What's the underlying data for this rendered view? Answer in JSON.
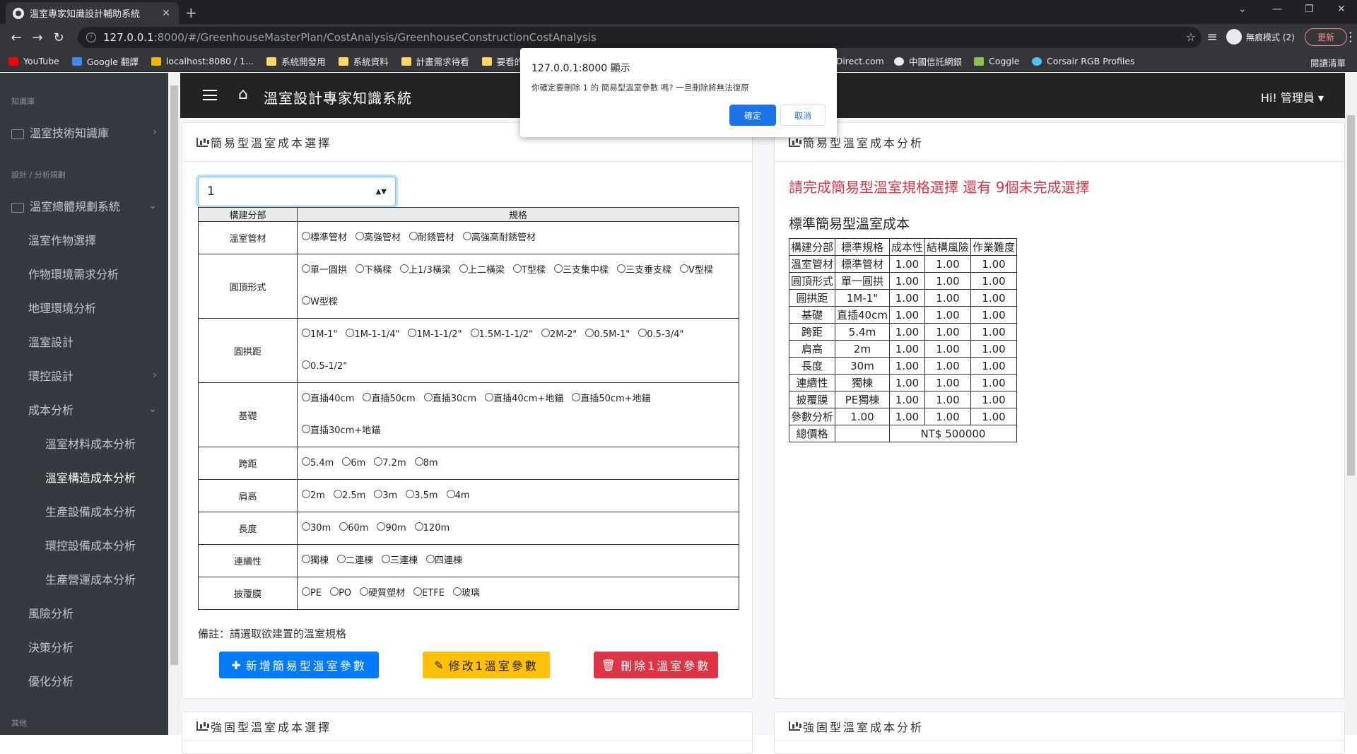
{
  "browser": {
    "tab_title": "溫室專家知識設計輔助系統",
    "url_host": "127.0.0.1",
    "url_path": ":8000/#/GreenhouseMasterPlan/CostAnalysis/GreenhouseConstructionCostAnalysis",
    "incognito_label": "無痕模式 (2)",
    "update_label": "更新",
    "reading_list": "閱讀清單",
    "bookmarks": [
      "YouTube",
      "Google 翻譯",
      "localhost:8080 / 1...",
      "系統開發用",
      "系統資料",
      "計畫需求待看",
      "要看的分",
      "eDirect.com",
      "中國信託網銀",
      "Coggle",
      "Corsair RGB Profiles"
    ]
  },
  "sidebar": {
    "head1": "知識庫",
    "item_kb": "溫室技術知識庫",
    "head2": "設計 / 分析規劃",
    "item_plan": "溫室總體規劃系統",
    "items": [
      "溫室作物選擇",
      "作物環境需求分析",
      "地理環境分析",
      "溫室設計",
      "環控設計",
      "成本分析"
    ],
    "subitems": [
      "溫室材料成本分析",
      "溫室構造成本分析",
      "生產設備成本分析",
      "環控設備成本分析",
      "生產營運成本分析"
    ],
    "items2": [
      "風險分析",
      "決策分析",
      "優化分析"
    ],
    "head3": "其他"
  },
  "navbar": {
    "brand": "溫室設計專家知識系統",
    "user": "Hi! 管理員"
  },
  "left_card": {
    "title": "簡易型溫室成本選擇",
    "select_value": "1",
    "col_part": "構建分部",
    "col_spec": "規格",
    "rows": [
      {
        "part": "溫室管材",
        "options": [
          "標準管材",
          "高強管材",
          "耐銹管材",
          "高強高耐銹管材"
        ]
      },
      {
        "part": "圓頂形式",
        "options": [
          "單一圓拱",
          "下橫樑",
          "上1/3橫梁",
          "上二橫梁",
          "T型樑",
          "三支集中樑",
          "三支垂支樑",
          "V型樑",
          "W型樑"
        ]
      },
      {
        "part": "圓拱距",
        "options": [
          "1M-1\"",
          "1M-1-1/4\"",
          "1M-1-1/2\"",
          "1.5M-1-1/2\"",
          "2M-2\"",
          "0.5M-1\"",
          "0.5-3/4\"",
          "0.5-1/2\""
        ]
      },
      {
        "part": "基礎",
        "options": [
          "直插40cm",
          "直插50cm",
          "直插30cm",
          "直插40cm+地錨",
          "直插50cm+地錨",
          "直插30cm+地錨"
        ]
      },
      {
        "part": "跨距",
        "options": [
          "5.4m",
          "6m",
          "7.2m",
          "8m"
        ]
      },
      {
        "part": "肩高",
        "options": [
          "2m",
          "2.5m",
          "3m",
          "3.5m",
          "4m"
        ]
      },
      {
        "part": "長度",
        "options": [
          "30m",
          "60m",
          "90m",
          "120m"
        ]
      },
      {
        "part": "連續性",
        "options": [
          "獨棟",
          "二連棟",
          "三連棟",
          "四連棟"
        ]
      },
      {
        "part": "披覆膜",
        "options": [
          "PE",
          "PO",
          "硬質塑材",
          "ETFE",
          "玻璃"
        ]
      }
    ],
    "note": "備註：請選取欲建置的溫室規格",
    "btn_add": "新增簡易型溫室參數",
    "btn_edit": "修改1溫室參數",
    "btn_delete": "刪除1溫室參數"
  },
  "right_card": {
    "title": "簡易型溫室成本分析",
    "warning": "請完成簡易型溫室規格選擇 還有 9個未完成選擇",
    "table_title": "標準簡易型溫室成本",
    "headers": [
      "構建分部",
      "標準規格",
      "成本性",
      "結構風險",
      "作業難度"
    ],
    "rows": [
      [
        "溫室管材",
        "標準管材",
        "1.00",
        "1.00",
        "1.00"
      ],
      [
        "圓頂形式",
        "單一圓拱",
        "1.00",
        "1.00",
        "1.00"
      ],
      [
        "圓拱距",
        "1M-1\"",
        "1.00",
        "1.00",
        "1.00"
      ],
      [
        "基礎",
        "直插40cm",
        "1.00",
        "1.00",
        "1.00"
      ],
      [
        "跨距",
        "5.4m",
        "1.00",
        "1.00",
        "1.00"
      ],
      [
        "肩高",
        "2m",
        "1.00",
        "1.00",
        "1.00"
      ],
      [
        "長度",
        "30m",
        "1.00",
        "1.00",
        "1.00"
      ],
      [
        "連續性",
        "獨棟",
        "1.00",
        "1.00",
        "1.00"
      ],
      [
        "披覆膜",
        "PE獨棟",
        "1.00",
        "1.00",
        "1.00"
      ],
      [
        "參數分析",
        "1.00",
        "1.00",
        "1.00",
        "1.00"
      ]
    ],
    "total_label": "總價格",
    "total_value": "NT$ 500000"
  },
  "bottom_cards": {
    "left": "強固型溫室成本選擇",
    "right": "強固型溫室成本分析"
  },
  "dialog": {
    "title": "127.0.0.1:8000 顯示",
    "message": "你確定要刪除 1 的 簡易型溫室參數 嗎? 一旦刪除將無法復原",
    "ok": "確定",
    "cancel": "取消"
  }
}
